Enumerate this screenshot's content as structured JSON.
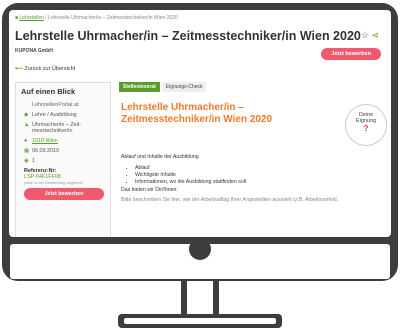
{
  "breadcrumb": {
    "home": "Lehrstellen",
    "trail": " / Lehrstelle Uhrmacher/in – Zeitmesstechniker/in Wien 2020"
  },
  "header": {
    "title": "Lehrstelle Uhrmacher/in – Zeitmesstechniker/in Wien 2020",
    "company": "KUPONA GmbH",
    "apply_label": "Jetzt bewerben",
    "star_icon": "star-icon",
    "share_icon": "share-icon"
  },
  "back_link": "Zurück zur Übersicht",
  "sidebar": {
    "title": "Auf einen Blick",
    "logo_text": "Lehrstellen",
    "logo_text2": "ortal.at",
    "type": "Lehre / Ausbildung",
    "profession": "Uhrmacher/in – Zeit-messtechniker/in",
    "location": "1010 Wien",
    "date": "06.09.2019",
    "count": "1",
    "ref_label": "Referenz-Nr:",
    "ref_id": "LSP-04F1FF08",
    "ref_note": "(bitte in der Bewerbung angeben)",
    "apply_label": "Jetzt bewerben"
  },
  "tabs": [
    "Stelleninserat",
    "Eignungs-Check"
  ],
  "job": {
    "title": "Lehrstelle Uhrmacher/in – Zeitmesstechniker/in Wien 2020",
    "fit_line1": "Deine",
    "fit_line2": "Eignung",
    "fit_value": "?"
  },
  "content": {
    "heading": "Ablauf und Inhalte der Ausbildung",
    "bullets": [
      "Ablauf",
      "Wichtigste Inhalte",
      "Informationen, wo die Ausbildung stattfinden soll"
    ],
    "offer": "Das bieten wir Dir/Ihnen:",
    "desc": "Bitte beschreiben Sie hier, wie der Arbeitsalltag Ihrer Angestellten aussieht (z.B. Arbeitsumfeld,"
  }
}
